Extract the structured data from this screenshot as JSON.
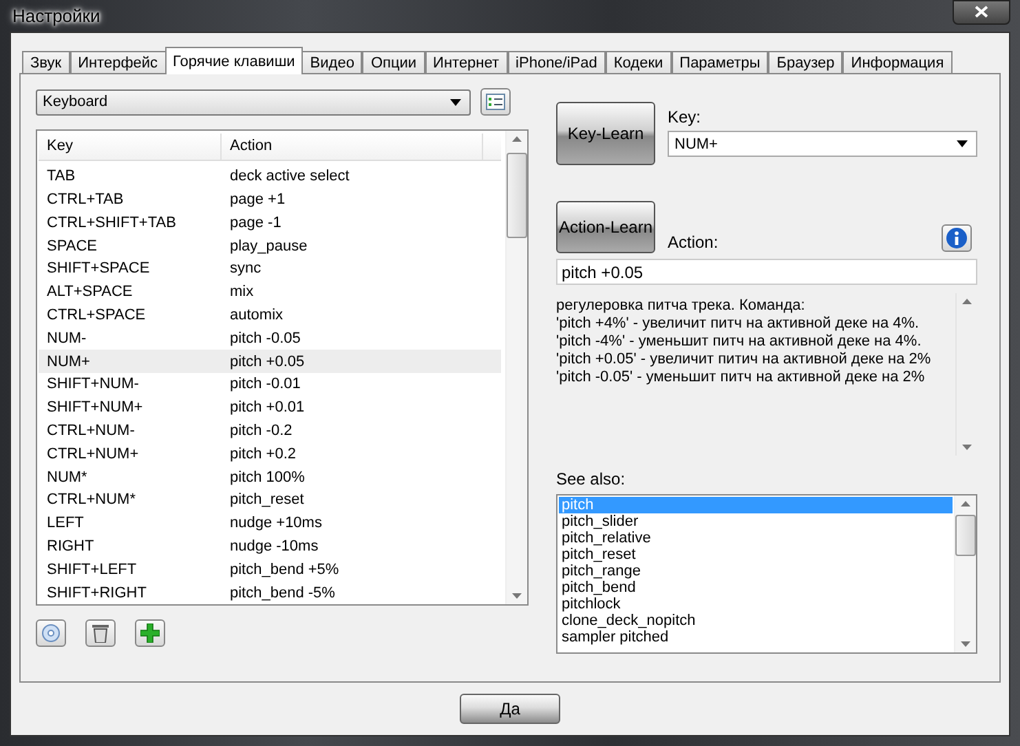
{
  "window": {
    "title": "Настройки"
  },
  "tabs": [
    {
      "label": "Звук",
      "selected": false
    },
    {
      "label": "Интерфейс",
      "selected": false
    },
    {
      "label": "Горячие клавиши",
      "selected": true
    },
    {
      "label": "Видео",
      "selected": false
    },
    {
      "label": "Опции",
      "selected": false
    },
    {
      "label": "Интернет",
      "selected": false
    },
    {
      "label": "iPhone/iPad",
      "selected": false
    },
    {
      "label": "Кодеки",
      "selected": false
    },
    {
      "label": "Параметры",
      "selected": false
    },
    {
      "label": "Браузер",
      "selected": false
    },
    {
      "label": "Информация",
      "selected": false
    }
  ],
  "device_select": {
    "value": "Keyboard"
  },
  "table": {
    "columns": [
      "Key",
      "Action"
    ],
    "rows": [
      {
        "key": "TAB",
        "action": "deck active select",
        "selected": false
      },
      {
        "key": "CTRL+TAB",
        "action": "page +1",
        "selected": false
      },
      {
        "key": "CTRL+SHIFT+TAB",
        "action": "page -1",
        "selected": false
      },
      {
        "key": "SPACE",
        "action": "play_pause",
        "selected": false
      },
      {
        "key": "SHIFT+SPACE",
        "action": "sync",
        "selected": false
      },
      {
        "key": "ALT+SPACE",
        "action": "mix",
        "selected": false
      },
      {
        "key": "CTRL+SPACE",
        "action": "automix",
        "selected": false
      },
      {
        "key": "NUM-",
        "action": "pitch -0.05",
        "selected": false
      },
      {
        "key": "NUM+",
        "action": "pitch +0.05",
        "selected": true
      },
      {
        "key": "SHIFT+NUM-",
        "action": "pitch -0.01",
        "selected": false
      },
      {
        "key": "SHIFT+NUM+",
        "action": "pitch +0.01",
        "selected": false
      },
      {
        "key": "CTRL+NUM-",
        "action": "pitch -0.2",
        "selected": false
      },
      {
        "key": "CTRL+NUM+",
        "action": "pitch +0.2",
        "selected": false
      },
      {
        "key": "NUM*",
        "action": "pitch 100%",
        "selected": false
      },
      {
        "key": "CTRL+NUM*",
        "action": "pitch_reset",
        "selected": false
      },
      {
        "key": "LEFT",
        "action": "nudge +10ms",
        "selected": false
      },
      {
        "key": "RIGHT",
        "action": "nudge -10ms",
        "selected": false
      },
      {
        "key": "SHIFT+LEFT",
        "action": "pitch_bend +5%",
        "selected": false
      },
      {
        "key": "SHIFT+RIGHT",
        "action": "pitch_bend -5%",
        "selected": false
      }
    ]
  },
  "key_learn_button": "Key-Learn",
  "key_field": {
    "label": "Key:",
    "value": "NUM+"
  },
  "action_learn_button": "Action-Learn",
  "action_field": {
    "label": "Action:",
    "value": "pitch +0.05"
  },
  "description": [
    "регулеровка питча трека. Команда:",
    "'pitch +4%' - увеличит питч на активной деке на 4%.",
    "'pitch -4%' - уменьшит питч на активной деке на 4%.",
    "'pitch +0.05' - увеличит питич на активной деке на 2%",
    "'pitch -0.05' - уменьшит питч на активной деке на 2%"
  ],
  "see_also": {
    "label": "See also:",
    "items": [
      {
        "label": "pitch",
        "selected": true
      },
      {
        "label": "pitch_slider",
        "selected": false
      },
      {
        "label": "pitch_relative",
        "selected": false
      },
      {
        "label": "pitch_reset",
        "selected": false
      },
      {
        "label": "pitch_range",
        "selected": false
      },
      {
        "label": "pitch_bend",
        "selected": false
      },
      {
        "label": "pitchlock",
        "selected": false
      },
      {
        "label": "clone_deck_nopitch",
        "selected": false
      },
      {
        "label": "sampler pitched",
        "selected": false
      }
    ]
  },
  "ok_button": "Да"
}
